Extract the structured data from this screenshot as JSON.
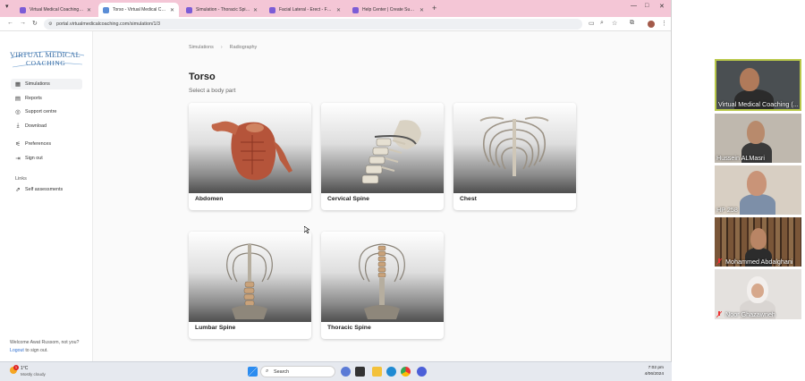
{
  "browser": {
    "tabs": [
      {
        "label": "Virtual Medical Coaching – Ca...",
        "fav_color": "#7b5cd6",
        "active": false
      },
      {
        "label": "Torso - Virtual Medical Coachin...",
        "fav_color": "#5a8dd6",
        "active": true
      },
      {
        "label": "Simulation - Thoracic Spine",
        "fav_color": "#7b5cd6",
        "active": false
      },
      {
        "label": "Facial Lateral - Erect - Facial Bo...",
        "fav_color": "#7b5cd6",
        "active": false
      },
      {
        "label": "Help Center | Create Support Ti...",
        "fav_color": "#7b5cd6",
        "active": false
      }
    ],
    "url": "portal.virtualmedicalcoaching.com/simulation/1/3",
    "new_tab": "+",
    "window_controls": {
      "minimize": "—",
      "maximize": "□",
      "close": "✕"
    }
  },
  "logo": {
    "line1": "VIRTUAL MEDICAL",
    "line2": "COACHING"
  },
  "sidebar": {
    "items": [
      {
        "icon": "grid-icon",
        "glyph": "▦",
        "label": "Simulations",
        "active": true
      },
      {
        "icon": "document-icon",
        "glyph": "▤",
        "label": "Reports",
        "active": false
      },
      {
        "icon": "support-icon",
        "glyph": "◎",
        "label": "Support centre",
        "active": false
      },
      {
        "icon": "download-icon",
        "glyph": "⤓",
        "label": "Download",
        "active": false
      },
      {
        "icon": "preferences-icon",
        "glyph": "⚟",
        "label": "Preferences",
        "active": false
      },
      {
        "icon": "signout-icon",
        "glyph": "⇥",
        "label": "Sign out",
        "active": false
      }
    ],
    "links_heading": "Links",
    "links": [
      {
        "icon": "external-link-icon",
        "glyph": "⇗",
        "label": "Self assessments"
      }
    ],
    "welcome": "Welcome Awat Russom, not you?",
    "logout_link": "Logout",
    "logout_suffix": " to sign out."
  },
  "main": {
    "breadcrumb": [
      "Simulations",
      "Radiography"
    ],
    "title": "Torso",
    "subtitle": "Select a body part",
    "cards": [
      {
        "label": "Abdomen",
        "icon": "abdomen-muscle-image"
      },
      {
        "label": "Cervical Spine",
        "icon": "cervical-spine-image"
      },
      {
        "label": "Chest",
        "icon": "ribcage-image"
      },
      {
        "label": "Lumbar Spine",
        "icon": "lumbar-spine-image"
      },
      {
        "label": "Thoracic Spine",
        "icon": "thoracic-spine-image"
      }
    ]
  },
  "taskbar": {
    "weather_temp": "1°C",
    "weather_desc": "Mostly cloudy",
    "weather_badge": "1",
    "search_placeholder": "Search",
    "time": "7:02 pm",
    "date": "4/06/2024"
  },
  "participants": [
    {
      "name": "Virtual Medical Coaching (...",
      "speaking": true,
      "muted": false
    },
    {
      "name": "Hussein ALMasri",
      "speaking": false,
      "muted": false
    },
    {
      "name": "HP 258",
      "speaking": false,
      "muted": false
    },
    {
      "name": "Mohammed Abdalghani",
      "speaking": false,
      "muted": true
    },
    {
      "name": "Noor Ghazawneh",
      "speaking": false,
      "muted": true
    }
  ],
  "colors": {
    "tabbar": "#f4c6d6",
    "brand": "#3a6ea5",
    "link": "#2f6fd0",
    "speaker_border": "#b9c84a"
  }
}
